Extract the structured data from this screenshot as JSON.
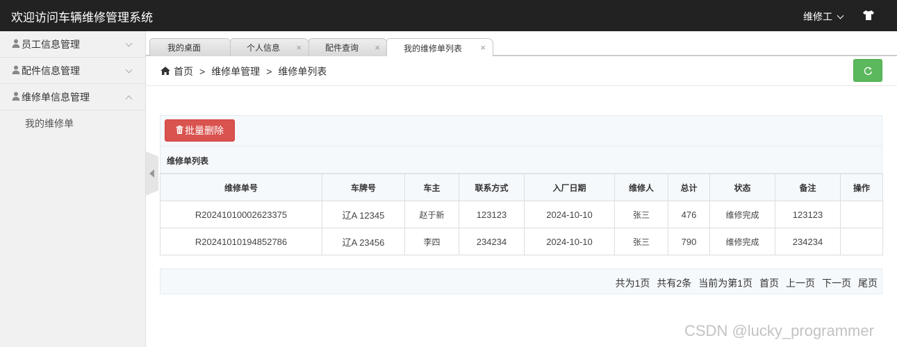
{
  "header": {
    "title": "欢迎访问车辆维修管理系统",
    "user": "维修工",
    "user_icon": "chevron-down-icon",
    "skin_icon": "tshirt-icon"
  },
  "sidebar": {
    "items": [
      {
        "label": "员工信息管理"
      },
      {
        "label": "配件信息管理"
      },
      {
        "label": "维修单信息管理"
      }
    ],
    "subitems": [
      {
        "label": "我的维修单"
      }
    ]
  },
  "tabs": [
    {
      "label": "我的桌面",
      "close": ""
    },
    {
      "label": "个人信息",
      "close": "×"
    },
    {
      "label": "配件查询",
      "close": "×"
    },
    {
      "label": "我的维修单列表",
      "close": "×"
    }
  ],
  "breadcrumb": {
    "home": "首页",
    "sep": ">",
    "level1": "维修单管理",
    "level2": "维修单列表"
  },
  "toolbar": {
    "batch_delete": "批量删除"
  },
  "list": {
    "title": "维修单列表",
    "columns": [
      "维修单号",
      "车牌号",
      "车主",
      "联系方式",
      "入厂日期",
      "维修人",
      "总计",
      "状态",
      "备注",
      "操作"
    ],
    "rows": [
      [
        "R20241010002623375",
        "辽A 12345",
        "赵于新",
        "123123",
        "2024-10-10",
        "张三",
        "476",
        "维修完成",
        "123123",
        ""
      ],
      [
        "R20241010194852786",
        "辽A 23456",
        "李四",
        "234234",
        "2024-10-10",
        "张三",
        "790",
        "维修完成",
        "234234",
        ""
      ]
    ]
  },
  "pager": {
    "total_pages": "共为1页",
    "total_items": "共有2条",
    "current": "当前为第1页",
    "first": "首页",
    "prev": "上一页",
    "next": "下一页",
    "last": "尾页"
  },
  "watermark": "CSDN @lucky_programmer",
  "colors": {
    "header_bg": "#222222",
    "danger": "#d9534f",
    "success": "#5cb85c"
  }
}
